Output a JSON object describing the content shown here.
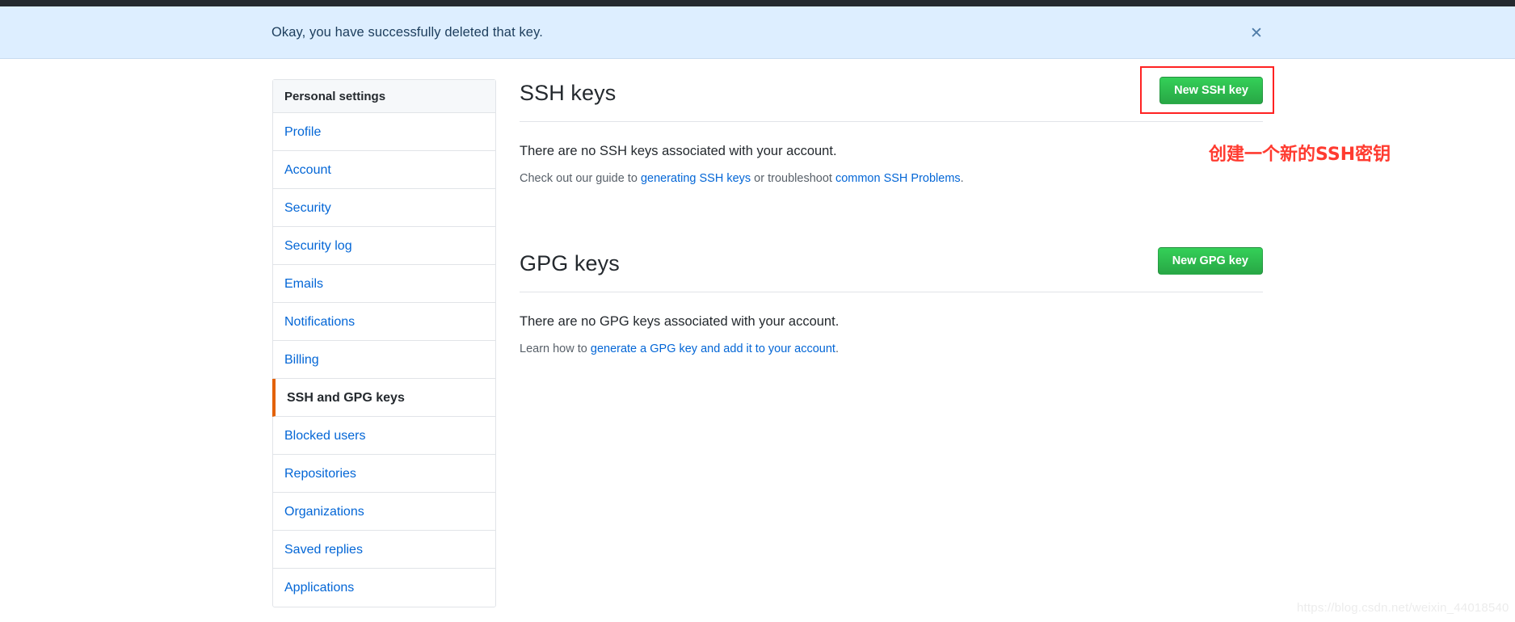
{
  "flash": {
    "message": "Okay, you have successfully deleted that key.",
    "close_icon": "close-icon",
    "close_glyph": "✕",
    "background_color": "#ddeeff",
    "text_color": "#1c3d5c"
  },
  "sidebar": {
    "header": "Personal settings",
    "active_accent_color": "#e36209",
    "items": [
      {
        "label": "Profile",
        "active": false
      },
      {
        "label": "Account",
        "active": false
      },
      {
        "label": "Security",
        "active": false
      },
      {
        "label": "Security log",
        "active": false
      },
      {
        "label": "Emails",
        "active": false
      },
      {
        "label": "Notifications",
        "active": false
      },
      {
        "label": "Billing",
        "active": false
      },
      {
        "label": "SSH and GPG keys",
        "active": true
      },
      {
        "label": "Blocked users",
        "active": false
      },
      {
        "label": "Repositories",
        "active": false
      },
      {
        "label": "Organizations",
        "active": false
      },
      {
        "label": "Saved replies",
        "active": false
      },
      {
        "label": "Applications",
        "active": false
      }
    ]
  },
  "ssh_section": {
    "title": "SSH keys",
    "button_label": "New SSH key",
    "empty_message": "There are no SSH keys associated with your account.",
    "help": {
      "prefix": "Check out our guide to ",
      "link1": "generating SSH keys",
      "middle": " or troubleshoot ",
      "link2": "common SSH Problems",
      "suffix": "."
    }
  },
  "gpg_section": {
    "title": "GPG keys",
    "button_label": "New GPG key",
    "empty_message": "There are no GPG keys associated with your account.",
    "help": {
      "prefix": "Learn how to ",
      "link1": "generate a GPG key and add it to your account",
      "suffix": "."
    }
  },
  "annotations": {
    "highlight_color": "#ff2222",
    "note_text": "创建一个新的SSH密钥",
    "note_color": "#ff3b30"
  },
  "watermark": {
    "text": "https://blog.csdn.net/weixin_44018540"
  },
  "theme": {
    "button_green": "#28a745",
    "link_blue": "#0366d6",
    "border_gray": "#e1e4e8"
  }
}
